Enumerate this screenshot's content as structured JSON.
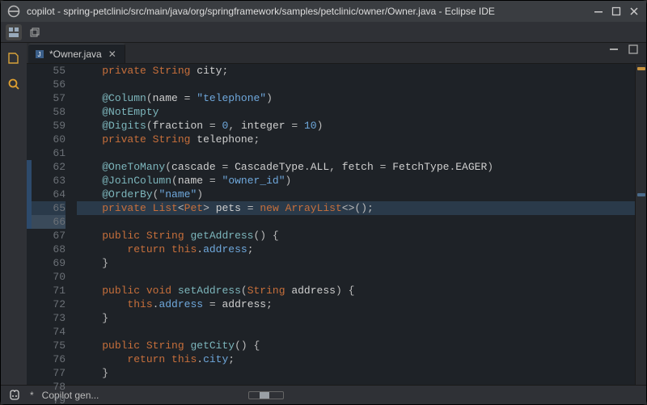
{
  "window": {
    "title": "copilot - spring-petclinic/src/main/java/org/springframework/samples/petclinic/owner/Owner.java - Eclipse IDE"
  },
  "tab": {
    "label": "*Owner.java"
  },
  "status": {
    "asterisk": "*",
    "message": "Copilot gen..."
  },
  "code": {
    "start": 55,
    "lines": [
      [
        [
          "kw",
          "private"
        ],
        [
          "",
          ""
        ],
        [
          "type",
          "String"
        ],
        [
          "",
          ""
        ],
        [
          "id",
          "city"
        ],
        [
          "punc",
          ";"
        ]
      ],
      [],
      [
        [
          "ann",
          "@Column"
        ],
        [
          "punc",
          "("
        ],
        [
          "id",
          "name"
        ],
        [
          "",
          ""
        ],
        [
          "punc",
          "="
        ],
        [
          "",
          ""
        ],
        [
          "str",
          "\"telephone\""
        ],
        [
          "punc",
          ")"
        ]
      ],
      [
        [
          "ann",
          "@NotEmpty"
        ]
      ],
      [
        [
          "ann",
          "@Digits"
        ],
        [
          "punc",
          "("
        ],
        [
          "id",
          "fraction"
        ],
        [
          "",
          ""
        ],
        [
          "punc",
          "="
        ],
        [
          "",
          ""
        ],
        [
          "num",
          "0"
        ],
        [
          "punc",
          ","
        ],
        [
          "",
          ""
        ],
        [
          "id",
          "integer"
        ],
        [
          "",
          ""
        ],
        [
          "punc",
          "="
        ],
        [
          "",
          ""
        ],
        [
          "num",
          "10"
        ],
        [
          "punc",
          ")"
        ]
      ],
      [
        [
          "kw",
          "private"
        ],
        [
          "",
          ""
        ],
        [
          "type",
          "String"
        ],
        [
          "",
          ""
        ],
        [
          "id",
          "telephone"
        ],
        [
          "punc",
          ";"
        ]
      ],
      [],
      [
        [
          "ann",
          "@OneToMany"
        ],
        [
          "punc",
          "("
        ],
        [
          "id",
          "cascade"
        ],
        [
          "",
          ""
        ],
        [
          "punc",
          "="
        ],
        [
          "",
          ""
        ],
        [
          "id",
          "CascadeType"
        ],
        [
          "punc",
          "."
        ],
        [
          "id",
          "ALL"
        ],
        [
          "punc",
          ","
        ],
        [
          "",
          ""
        ],
        [
          "id",
          "fetch"
        ],
        [
          "",
          ""
        ],
        [
          "punc",
          "="
        ],
        [
          "",
          ""
        ],
        [
          "id",
          "FetchType"
        ],
        [
          "punc",
          "."
        ],
        [
          "id",
          "EAGER"
        ],
        [
          "punc",
          ")"
        ]
      ],
      [
        [
          "ann",
          "@JoinColumn"
        ],
        [
          "punc",
          "("
        ],
        [
          "id",
          "name"
        ],
        [
          "",
          ""
        ],
        [
          "punc",
          "="
        ],
        [
          "",
          ""
        ],
        [
          "str",
          "\"owner_id\""
        ],
        [
          "punc",
          ")"
        ]
      ],
      [
        [
          "ann",
          "@OrderBy"
        ],
        [
          "punc",
          "("
        ],
        [
          "str",
          "\"name\""
        ],
        [
          "punc",
          ")"
        ]
      ],
      [
        [
          "kw",
          "private"
        ],
        [
          "",
          ""
        ],
        [
          "type",
          "List"
        ],
        [
          "punc",
          "<"
        ],
        [
          "type",
          "Pet"
        ],
        [
          "punc",
          ">"
        ],
        [
          "",
          ""
        ],
        [
          "id",
          "pets"
        ],
        [
          "",
          ""
        ],
        [
          "punc",
          "="
        ],
        [
          "",
          ""
        ],
        [
          "kw",
          "new"
        ],
        [
          "",
          ""
        ],
        [
          "type",
          "ArrayList"
        ],
        [
          "punc",
          "<>"
        ],
        [
          "punc",
          "();"
        ]
      ],
      [],
      [
        [
          "kw",
          "public"
        ],
        [
          "",
          ""
        ],
        [
          "type",
          "String"
        ],
        [
          "",
          ""
        ],
        [
          "mtd",
          "getAddress"
        ],
        [
          "punc",
          "()"
        ],
        [
          "",
          ""
        ],
        [
          "punc",
          "{"
        ]
      ],
      [
        [
          "",
          "    "
        ],
        [
          "kw",
          "return"
        ],
        [
          "",
          ""
        ],
        [
          "kw",
          "this"
        ],
        [
          "punc",
          "."
        ],
        [
          "field",
          "address"
        ],
        [
          "punc",
          ";"
        ]
      ],
      [
        [
          "punc",
          "}"
        ]
      ],
      [],
      [
        [
          "kw",
          "public"
        ],
        [
          "",
          ""
        ],
        [
          "kw",
          "void"
        ],
        [
          "",
          ""
        ],
        [
          "mtd",
          "setAddress"
        ],
        [
          "punc",
          "("
        ],
        [
          "type",
          "String"
        ],
        [
          "",
          ""
        ],
        [
          "id",
          "address"
        ],
        [
          "punc",
          ")"
        ],
        [
          "",
          ""
        ],
        [
          "punc",
          "{"
        ]
      ],
      [
        [
          "",
          "    "
        ],
        [
          "kw",
          "this"
        ],
        [
          "punc",
          "."
        ],
        [
          "field",
          "address"
        ],
        [
          "",
          ""
        ],
        [
          "punc",
          "="
        ],
        [
          "",
          ""
        ],
        [
          "id",
          "address"
        ],
        [
          "punc",
          ";"
        ]
      ],
      [
        [
          "punc",
          "}"
        ]
      ],
      [],
      [
        [
          "kw",
          "public"
        ],
        [
          "",
          ""
        ],
        [
          "type",
          "String"
        ],
        [
          "",
          ""
        ],
        [
          "mtd",
          "getCity"
        ],
        [
          "punc",
          "()"
        ],
        [
          "",
          ""
        ],
        [
          "punc",
          "{"
        ]
      ],
      [
        [
          "",
          "    "
        ],
        [
          "kw",
          "return"
        ],
        [
          "",
          ""
        ],
        [
          "kw",
          "this"
        ],
        [
          "punc",
          "."
        ],
        [
          "field",
          "city"
        ],
        [
          "punc",
          ";"
        ]
      ],
      [
        [
          "punc",
          "}"
        ]
      ],
      [],
      []
    ],
    "currentLine": 65,
    "hlRange": [
      62,
      66
    ],
    "indent": "    "
  }
}
